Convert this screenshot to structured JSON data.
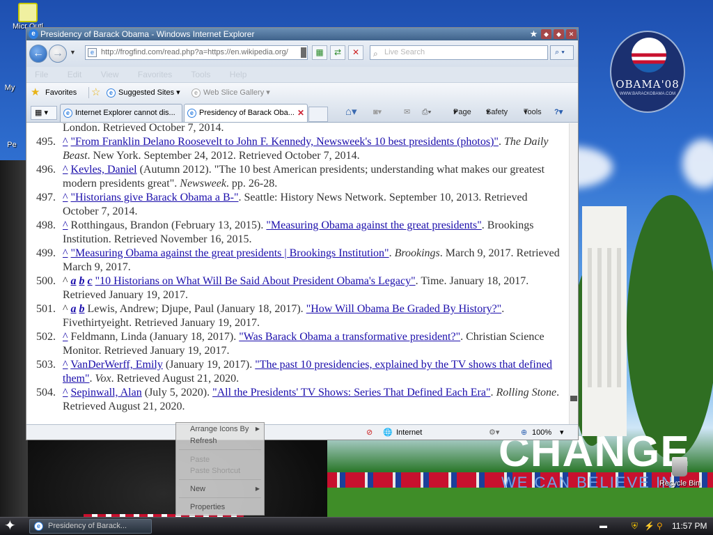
{
  "window": {
    "title": "Presidency of Barack Obama - Windows Internet Explorer"
  },
  "address": {
    "url": "http://frogfind.com/read.php?a=https://en.wikipedia.org/",
    "search_placeholder": "Live Search"
  },
  "menu": {
    "items": [
      "File",
      "Edit",
      "View",
      "Favorites",
      "Tools",
      "Help"
    ]
  },
  "favorites_bar": {
    "favorites_label": "Favorites",
    "suggested_sites": "Suggested Sites",
    "web_slice_gallery": "Web Slice Gallery"
  },
  "tabs": [
    {
      "label": "Internet Explorer cannot dis..."
    },
    {
      "label": "Presidency of Barack Oba..."
    }
  ],
  "command_bar": {
    "page": "Page",
    "safety": "Safety",
    "tools": "Tools"
  },
  "content": {
    "top_fragment": "London. Retrieved October 7, 2014.",
    "refs": [
      {
        "num": "495.",
        "caret": "^",
        "link1": "\"From Franklin Delano Roosevelt to John F. Kennedy, Newsweek's 10 best presidents (photos)\"",
        "after1": ".",
        "italic": "The Daily Beast",
        "tail": ". New York. September 24, 2012. Retrieved October 7, 2014."
      },
      {
        "num": "496.",
        "caret": "^",
        "author_link": "Kevles, Daniel",
        "text": " (Autumn 2012). \"The 10 best American presidents; understanding what makes our greatest modern presidents great\". ",
        "italic": "Newsweek",
        "tail": ". pp. 26-28."
      },
      {
        "num": "497.",
        "caret": "^",
        "link1": "\"Historians give Barack Obama a B-\"",
        "tail": ". Seattle: History News Network. September 10, 2013. Retrieved October 7, 2014."
      },
      {
        "num": "498.",
        "caret": "^",
        "text": " Rotthingaus, Brandon (February 13, 2015). ",
        "link1": "\"Measuring Obama against the great presidents\"",
        "tail": ". Brookings Institution. Retrieved November 16, 2015."
      },
      {
        "num": "499.",
        "caret": "^",
        "link1": "\"Measuring Obama against the great presidents | Brookings Institution\"",
        "after1": ". ",
        "italic": "Brookings",
        "tail": ". March 9, 2017. Retrieved March 9, 2017."
      },
      {
        "num": "500.",
        "caret": "^",
        "a": "a",
        "b": "b",
        "c": "c",
        "link1": "\"10 Historians on What Will Be Said About President Obama's Legacy\"",
        "tail": ". Time. January 18, 2017. Retrieved January 19, 2017."
      },
      {
        "num": "501.",
        "caret": "^",
        "a": "a",
        "b": "b",
        "text": " Lewis, Andrew; Djupe, Paul (January 18, 2017). ",
        "link1": "\"How Will Obama Be Graded By History?\"",
        "tail": ". Fivethirtyeight. Retrieved January 19, 2017."
      },
      {
        "num": "502.",
        "caret": "^",
        "text": " Feldmann, Linda (January 18, 2017). ",
        "link1": "\"Was Barack Obama a transformative president?\"",
        "tail": ". Christian Science Monitor. Retrieved January 19, 2017."
      },
      {
        "num": "503.",
        "caret": "^",
        "author_link": "VanDerWerff, Emily",
        "text": " (January 19, 2017). ",
        "link1": "\"The past 10 presidencies, explained by the TV shows that defined them\"",
        "after1": ". ",
        "italic": "Vox",
        "tail": ". Retrieved August 21, 2020."
      },
      {
        "num": "504.",
        "caret": "^",
        "author_link": "Sepinwall, Alan",
        "text": " (July 5, 2020). ",
        "link1": "\"All the Presidents' TV Shows: Series That Defined Each Era\"",
        "after1": ". ",
        "italic": "Rolling Stone",
        "tail": ". Retrieved August 21, 2020."
      }
    ]
  },
  "status_bar": {
    "zone": "Internet",
    "zoom": "100%"
  },
  "context_menu": {
    "items": [
      "Arrange Icons By",
      "Refresh",
      "Paste",
      "Paste Shortcut",
      "New",
      "Properties"
    ]
  },
  "desktop": {
    "icon1_label": "Micr Outl",
    "icon2_label": "My",
    "icon3_label": "Pe",
    "recycle_bin": "Recycle Bin",
    "logo_text": "OBAMA'08",
    "logo_sub": "WWW.BARACKOBAMA.COM",
    "slogan_big": "CHANGE",
    "slogan_small": "WE CAN BELIEVE IN"
  },
  "taskbar": {
    "task_label": "Presidency of Barack...",
    "clock": "11:57 PM"
  },
  "colors": {
    "link": "#1a0dab",
    "titlebar": "#3f628b",
    "taskbar": "#141418"
  }
}
